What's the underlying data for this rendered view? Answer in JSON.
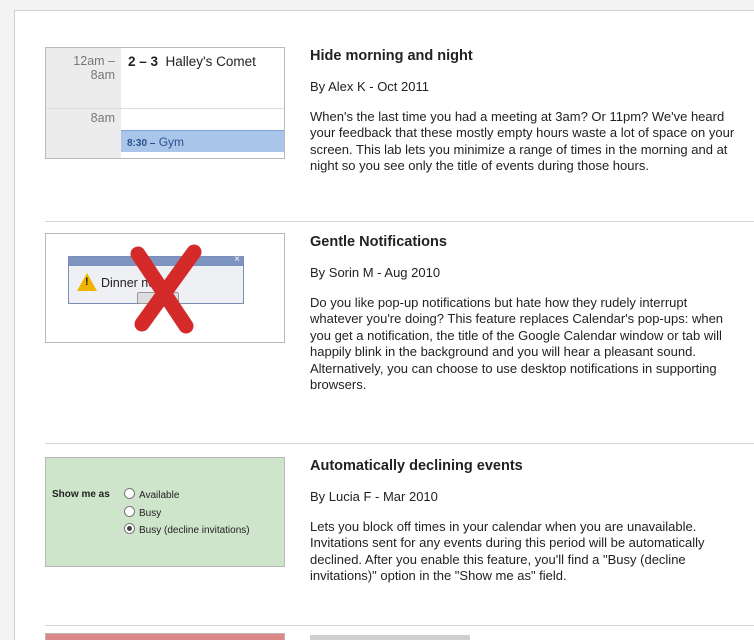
{
  "labs": [
    {
      "title": "Hide morning and night",
      "byline": "By Alex K - Oct 2011",
      "description": "When's the last time you had a meeting at 3am? Or 11pm? We've heard your feedback that these mostly empty hours waste a lot of space on your screen. This lab lets you minimize a range of times in the morning and at night so you see only the title of events during those hours.",
      "preview": {
        "time_range_start": "12am –",
        "time_range_end": "8am",
        "event_time": "2 – 3",
        "event_title": "Halley's Comet",
        "time_label": "8am",
        "gym_time": "8:30 –",
        "gym_title": "Gym"
      }
    },
    {
      "title": "Gentle Notifications",
      "byline": "By Sorin M - Aug 2010",
      "description": "Do you like pop-up notifications but hate how they rudely interrupt whatever you're doing? This feature replaces Calendar's pop-ups: when you get a notification, the title of the Google Calendar window or tab will happily blink in the background and you will hear a pleasant sound. Alternatively, you can choose to use desktop notifications in supporting browsers.",
      "preview": {
        "dialog_text": "Dinner    ncho's",
        "close_glyph": "×",
        "warning_glyph": "!"
      }
    },
    {
      "title": "Automatically declining events",
      "byline": "By Lucia F - Mar 2010",
      "description": "Lets you block off times in your calendar when you are unavailable. Invitations sent for any events during this period will be automatically declined. After you enable this feature, you'll find a \"Busy (decline invitations)\" option in the \"Show me as\" field.",
      "preview": {
        "label": "Show me as",
        "options": [
          "Available",
          "Busy",
          "Busy (decline invitations)"
        ],
        "selected_index": 2
      }
    }
  ],
  "colors": {
    "calendar_gutter": "#ececec",
    "gym_event": "#a9c6ea",
    "notify_titlebar": "#7d93c0",
    "warning": "#f0b400",
    "red_x": "#d42a2a",
    "showme_bg": "#cfe5cb"
  }
}
